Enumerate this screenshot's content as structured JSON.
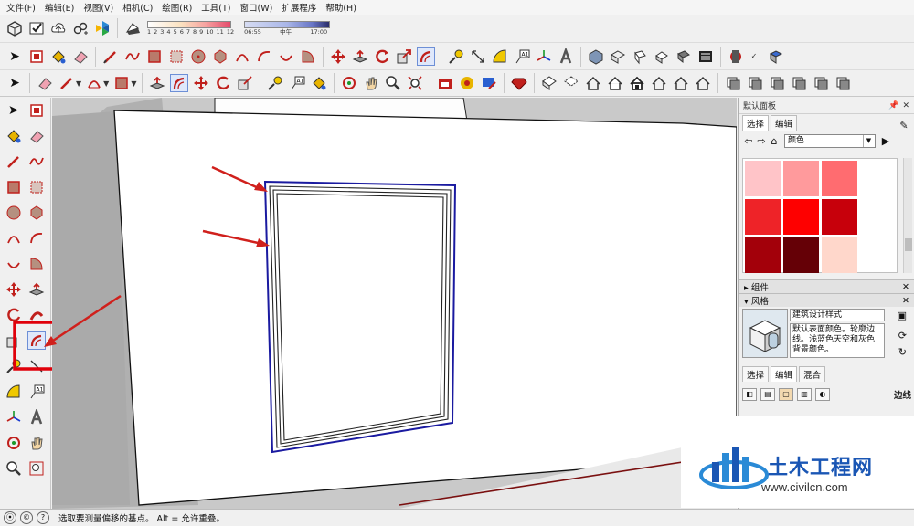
{
  "menu": [
    "文件(F)",
    "编辑(E)",
    "视图(V)",
    "相机(C)",
    "绘图(R)",
    "工具(T)",
    "窗口(W)",
    "扩展程序",
    "帮助(H)"
  ],
  "shadow": {
    "month_labels": [
      "1",
      "2",
      "3",
      "4",
      "5",
      "6",
      "7",
      "8",
      "9",
      "10",
      "11",
      "12"
    ],
    "time_start": "06:55",
    "time_mid": "中午",
    "time_end": "17:00"
  },
  "panel": {
    "title": "默认面板",
    "tab_select": "选择",
    "tab_edit": "编辑",
    "materials_dropdown": "颜色",
    "swatches": [
      "#ffc4c8",
      "#ff9a9c",
      "#ff6c70",
      "#ee2328",
      "#fe0000",
      "#c7000b",
      "#a3000a",
      "#650006",
      "#ffd7cb"
    ],
    "components_header": "组件",
    "styles_header": "风格",
    "style_name": "建筑设计样式",
    "style_description": "默认表面颜色。轮廓边线。浅蓝色天空和灰色背景颜色。",
    "styles_tabs": [
      "选择",
      "编辑",
      "混合"
    ],
    "edge_label": "边线"
  },
  "status": {
    "text": "选取要测量偏移的基点。 Alt = 允许重叠。"
  },
  "watermark": {
    "name": "土木工程网",
    "url": "www.civilcn.com"
  },
  "colors": {
    "arrow_red": "#d0201c",
    "window_outline": "#1a1aa0",
    "highlight_box": "#e0000a"
  }
}
